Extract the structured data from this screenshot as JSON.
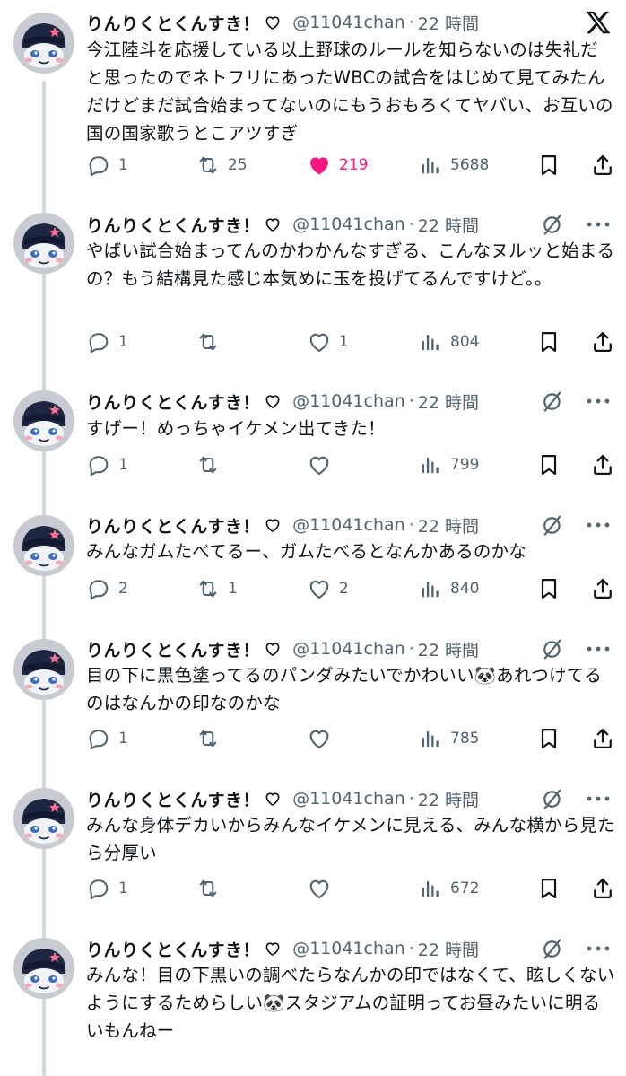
{
  "author": {
    "name": "りんりくとくんすき！",
    "handle": "@11041chan",
    "badge_icon": "heart-outline-icon"
  },
  "top_icon": "x-logo-icon",
  "tweets": [
    {
      "time": "22 時間",
      "text": "今江陸斗を応援している以上野球のルールを知らないのは失礼だと思ったのでネトフリにあったWBCの試合をはじめて見てみたんだけどまだ試合始まってないのにもうおもろくてヤバい、お互いの国の国家歌うとこアツすぎ",
      "replies": "1",
      "reposts": "25",
      "likes": "219",
      "views": "5688",
      "liked": true
    },
    {
      "time": "22 時間",
      "text": "やばい試合始まってんのかわかんなすぎる、こんなヌルッと始まるの？もう結構見た感じ本気めに玉を投げてるんですけど。。",
      "replies": "1",
      "reposts": "",
      "likes": "1",
      "views": "804"
    },
    {
      "time": "22 時間",
      "text": "すげー！めっちゃイケメン出てきた！",
      "replies": "1",
      "reposts": "",
      "likes": "",
      "views": "799"
    },
    {
      "time": "22 時間",
      "text": "みんなガムたべてるー、ガムたべるとなんかあるのかな",
      "replies": "2",
      "reposts": "1",
      "likes": "2",
      "views": "840"
    },
    {
      "time": "22 時間",
      "text": "目の下に黒色塗ってるのパンダみたいでかわいい🐼あれつけてるのはなんかの印なのかな",
      "replies": "1",
      "reposts": "",
      "likes": "",
      "views": "785"
    },
    {
      "time": "22 時間",
      "text": "みんな身体デカいからみんなイケメンに見える、みんな横から見たら分厚い",
      "replies": "1",
      "reposts": "",
      "likes": "",
      "views": "672"
    },
    {
      "time": "22 時間",
      "text": "みんな！目の下黒いの調べたらなんかの印ではなくて、眩しくないようにするためらしい🐼スタジアムの証明ってお昼みたいに明るいもんねー",
      "replies": "",
      "reposts": "",
      "likes": "",
      "views": ""
    }
  ]
}
